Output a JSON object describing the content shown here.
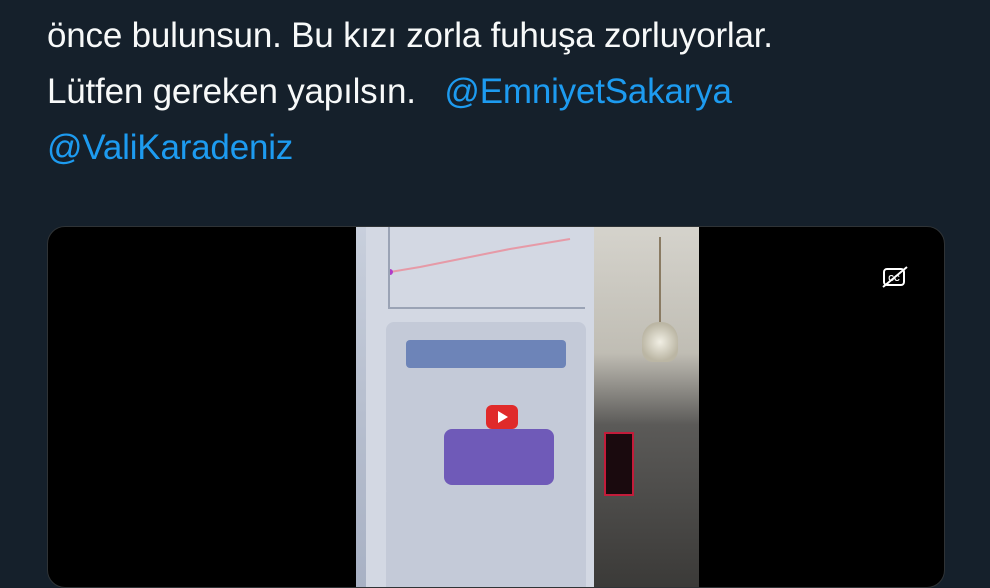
{
  "tweet": {
    "lines": [
      "önce bulunsun. Bu kızı zorla fuhuşa zorluyorlar.",
      "Lütfen gereken yapılsın."
    ],
    "mentions": [
      "@EmniyetSakarya",
      "@ValiKaradeniz"
    ]
  },
  "media": {
    "captions_icon": "closed-captions-off-icon"
  },
  "colors": {
    "background": "#15202b",
    "text": "#f7f9f9",
    "mention": "#1d9bf0"
  }
}
